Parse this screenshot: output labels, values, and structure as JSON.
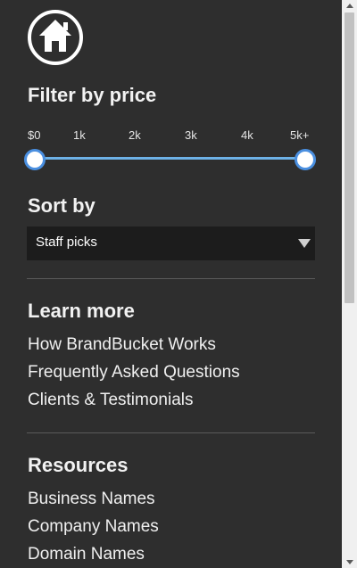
{
  "logo": {
    "icon": "home-icon"
  },
  "filter": {
    "title": "Filter by price",
    "ticks": [
      "$0",
      "1k",
      "2k",
      "3k",
      "4k",
      "5k+"
    ],
    "range_low": 0,
    "range_high": 5
  },
  "sort": {
    "title": "Sort by",
    "selected": "Staff picks"
  },
  "learn_more": {
    "title": "Learn more",
    "links": [
      "How BrandBucket Works",
      "Frequently Asked Questions",
      "Clients & Testimonials"
    ]
  },
  "resources": {
    "title": "Resources",
    "links": [
      "Business Names",
      "Company Names",
      "Domain Names"
    ]
  },
  "colors": {
    "background": "#2e2e2e",
    "slider_track": "#6db1e6",
    "slider_handle_border": "#4a8fe0",
    "select_bg": "#1c1c1c"
  }
}
